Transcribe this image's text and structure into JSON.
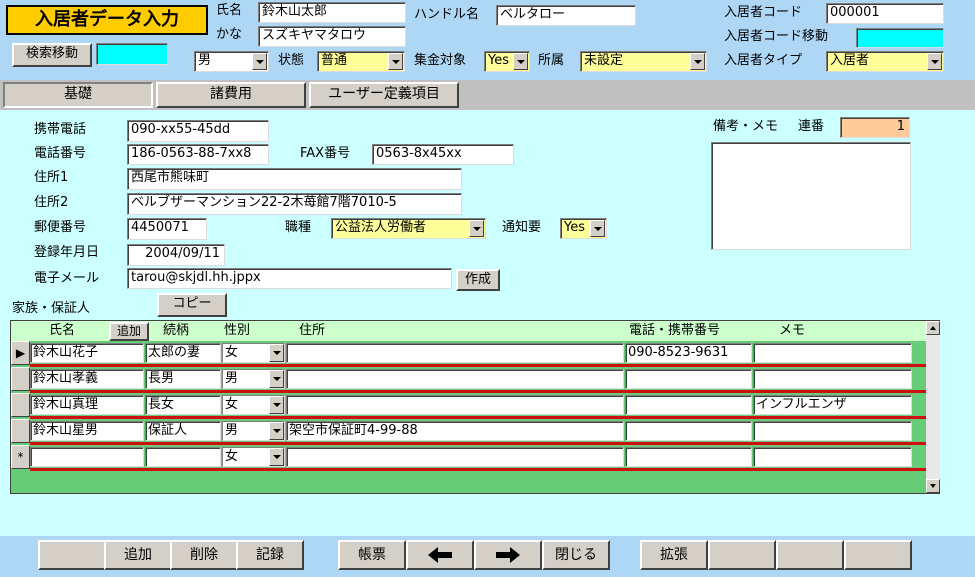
{
  "header": {
    "title": "入居者データ入力",
    "name_label": "氏名",
    "name_value": "鈴木山太郎",
    "kana_label": "かな",
    "kana_value": "スズキヤマタロウ",
    "handle_label": "ハンドル名",
    "handle_value": "ベルタロー",
    "code_label": "入居者コード",
    "code_value": "000001",
    "code_move_label": "入居者コード移動",
    "code_move_value": "",
    "search_move_label": "検索移動",
    "search_move_value": "",
    "gender_value": "男",
    "status_label": "状態",
    "status_value": "普通",
    "collect_label": "集金対象",
    "collect_value": "Yes",
    "affiliation_label": "所属",
    "affiliation_value": "未設定",
    "type_label": "入居者タイプ",
    "type_value": "入居者"
  },
  "tabs": [
    {
      "label": "基礎",
      "active": true
    },
    {
      "label": "諸費用",
      "active": false
    },
    {
      "label": "ユーザー定義項目",
      "active": false
    }
  ],
  "basic": {
    "mobile_label": "携帯電話",
    "mobile_value": "090-xx55-45dd",
    "phone_label": "電話番号",
    "phone_value": "186-0563-88-7xx8",
    "fax_label": "FAX番号",
    "fax_value": "0563-8x45xx",
    "address1_label": "住所1",
    "address1_value": "西尾市熊味町",
    "address2_label": "住所2",
    "address2_value": "ベルブザーマンション22-2木苺館7階7010-5",
    "zip_label": "郵便番号",
    "zip_value": "4450071",
    "job_label": "職種",
    "job_value": "公益法人労働者",
    "notice_label": "通知要",
    "notice_value": "Yes",
    "regdate_label": "登録年月日",
    "regdate_value": "2004/09/11",
    "email_label": "電子メール",
    "email_value": "tarou@skjdl.hh.jppx",
    "create_button": "作成",
    "memo_label": "備考・メモ",
    "serial_label": "連番",
    "serial_value": "1",
    "memo_value": ""
  },
  "family": {
    "section_label": "家族・保証人",
    "copy_button": "コピー",
    "add_button": "追加",
    "columns": {
      "name": "氏名",
      "relation": "続柄",
      "gender": "性別",
      "address": "住所",
      "phone": "電話・携帯番号",
      "memo": "メモ"
    },
    "rows": [
      {
        "marker": "▶",
        "name": "鈴木山花子",
        "relation": "太郎の妻",
        "gender": "女",
        "address": "",
        "phone": "090-8523-9631",
        "memo": ""
      },
      {
        "marker": "",
        "name": "鈴木山孝義",
        "relation": "長男",
        "gender": "男",
        "address": "",
        "phone": "",
        "memo": ""
      },
      {
        "marker": "",
        "name": "鈴木山真理",
        "relation": "長女",
        "gender": "女",
        "address": "",
        "phone": "",
        "memo": "インフルエンザ"
      },
      {
        "marker": "",
        "name": "鈴木山星男",
        "relation": "保証人",
        "gender": "男",
        "address": "架空市保証町4-99-88",
        "phone": "",
        "memo": ""
      },
      {
        "marker": "*",
        "name": "",
        "relation": "",
        "gender": "女",
        "address": "",
        "phone": "",
        "memo": ""
      }
    ]
  },
  "footer": {
    "add": "追加",
    "delete": "削除",
    "save": "記録",
    "ledger": "帳票",
    "close": "閉じる",
    "expand": "拡張"
  }
}
